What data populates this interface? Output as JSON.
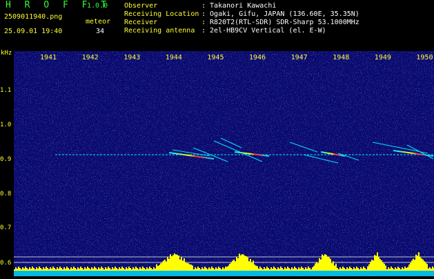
{
  "header": {
    "app_title": "H R O F F T",
    "app_version": "1.0.0",
    "filename": "2509011940.png",
    "datetime": "25.09.01 19:40",
    "meteor_label": "meteor",
    "meteor_count": "34",
    "info": [
      {
        "label": "Observer",
        "value": ": Takanori Kawachi"
      },
      {
        "label": "Receiving Location",
        "value": ": Ogaki, Gifu, JAPAN (136.60E, 35.35N)"
      },
      {
        "label": "Receiver",
        "value": ": R820T2(RTL-SDR) SDR-Sharp 53.1000MHz"
      },
      {
        "label": "Receiving antenna",
        "value": ": 2el-HB9CV Vertical (el. E-W)"
      }
    ]
  },
  "axis": {
    "y_unit": "kHz",
    "x_ticks": [
      "1941",
      "1942",
      "1943",
      "1944",
      "1945",
      "1946",
      "1947",
      "1948",
      "1949",
      "1950"
    ],
    "y_ticks": [
      "1.1",
      "1.0",
      "0.9",
      "0.8",
      "0.7",
      "0.6"
    ]
  },
  "colors": {
    "background": "#000000",
    "waterfall": "#0a0a6e",
    "label_yellow": "#ffff33",
    "title_green": "#33ff33",
    "signal_cyan": "#00e5ff",
    "level_yellow": "#ffff00"
  }
}
